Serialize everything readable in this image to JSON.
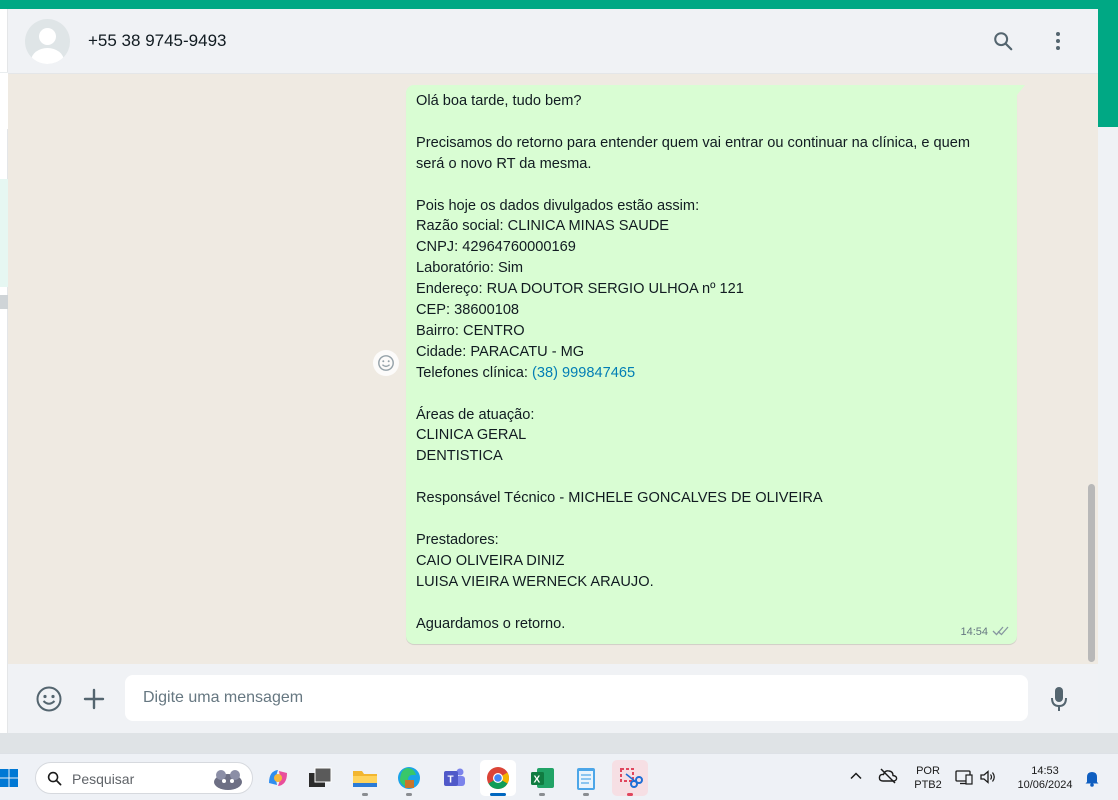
{
  "header": {
    "contact_name": "+55 38 9745-9493"
  },
  "message": {
    "lines": [
      "Olá boa tarde, tudo bem?",
      "",
      "Precisamos do retorno para entender quem vai entrar ou continuar na clínica, e quem",
      "será o novo RT da mesma.",
      "",
      "Pois hoje os dados divulgados estão assim:",
      "Razão social: CLINICA MINAS SAUDE",
      "CNPJ: 42964760000169",
      "Laboratório: Sim",
      "Endereço: RUA DOUTOR SERGIO ULHOA nº 121",
      "CEP: 38600108",
      "Bairro: CENTRO",
      "Cidade: PARACATU - MG"
    ],
    "phone_label": "Telefones clínica: ",
    "phone_link": "(38) 999847465",
    "lines_after": [
      "",
      "Áreas de atuação:",
      "CLINICA GERAL",
      "DENTISTICA",
      "",
      "Responsável Técnico - MICHELE GONCALVES DE OLIVEIRA",
      "",
      "Prestadores:",
      "CAIO OLIVEIRA DINIZ",
      "LUISA VIEIRA WERNECK ARAUJO.",
      "",
      "Aguardamos o retorno."
    ],
    "time": "14:54",
    "status_icon": "double-check-icon"
  },
  "composer": {
    "placeholder": "Digite uma mensagem"
  },
  "taskbar": {
    "search_label": "Pesquisar",
    "language_line1": "POR",
    "language_line2": "PTB2",
    "clock_time": "14:53",
    "clock_date": "10/06/2024",
    "apps": [
      "copilot-icon",
      "terminal-icon",
      "file-explorer-icon",
      "edge-icon",
      "teams-icon",
      "chrome-icon",
      "excel-icon",
      "notepad-icon",
      "snipping-tool-icon"
    ]
  },
  "colors": {
    "accent": "#00a884",
    "bubble_outgoing": "#d9fdd3",
    "chat_background": "#efeae2",
    "link": "#027eb5"
  }
}
